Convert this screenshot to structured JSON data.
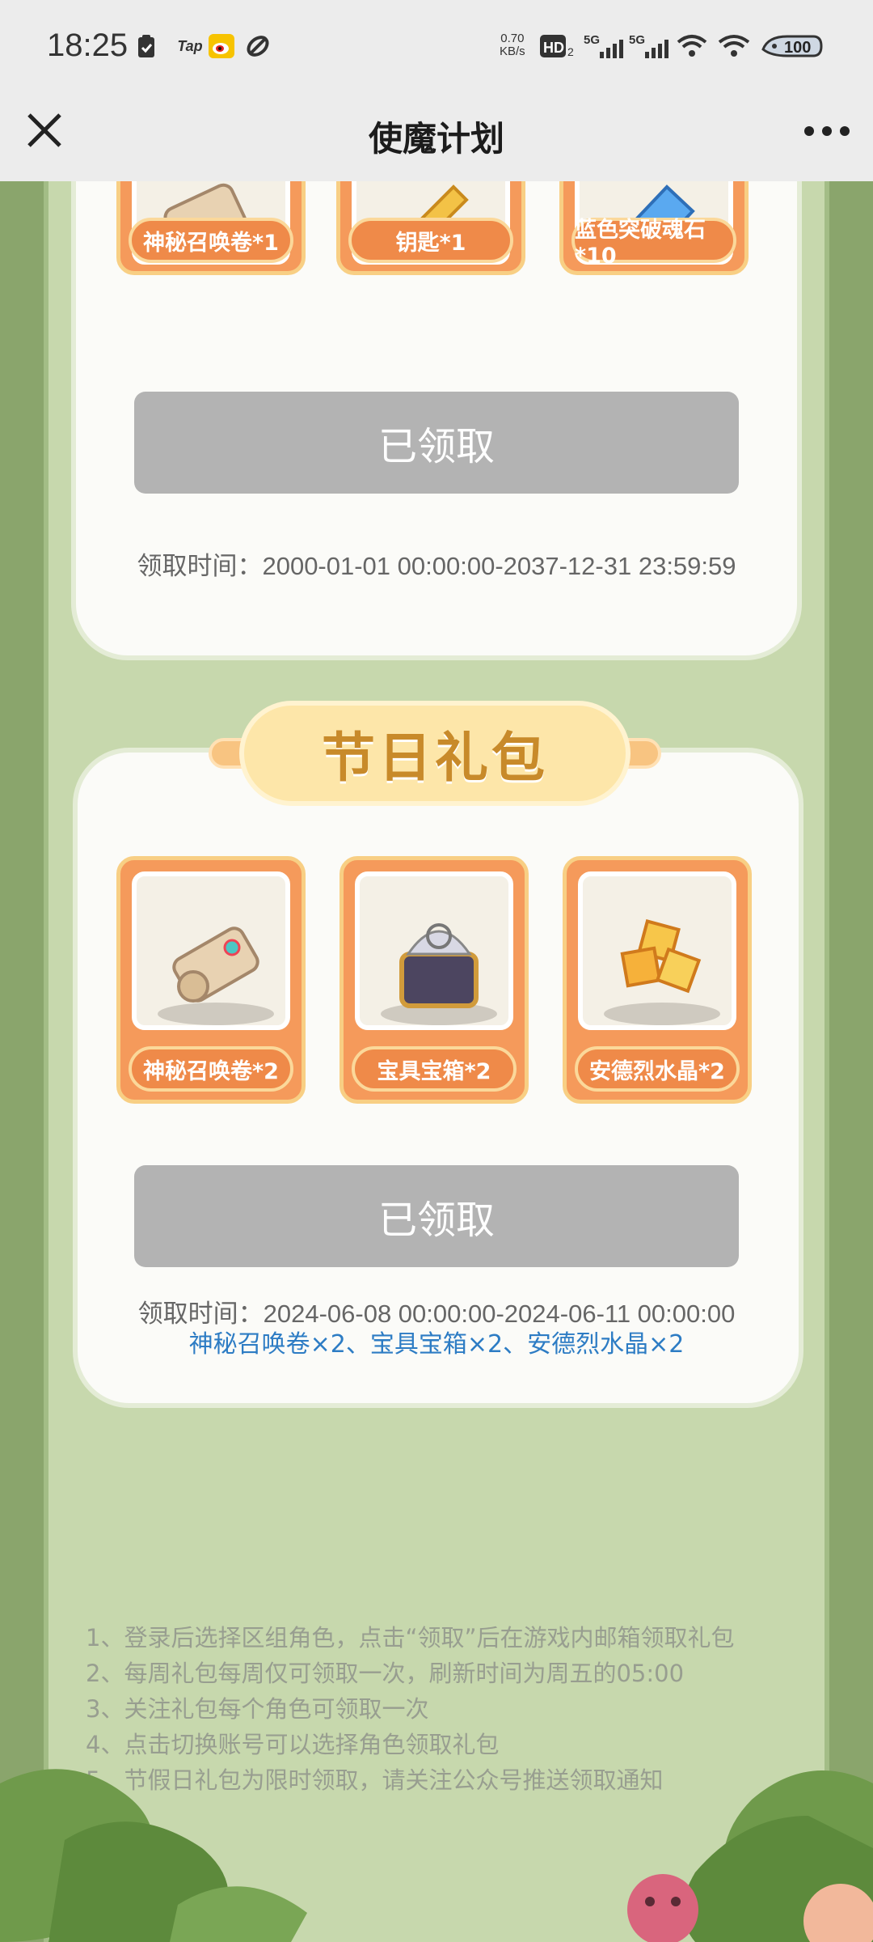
{
  "status_bar": {
    "time": "18:25",
    "tap_label": "Tap",
    "speed_value": "0.70",
    "speed_unit": "KB/s",
    "network1": "5G",
    "network2": "5G",
    "battery": "100"
  },
  "header": {
    "title": "使魔计划"
  },
  "weekly_gift": {
    "items": [
      {
        "label": "神秘召唤卷*1",
        "icon": "scroll-icon"
      },
      {
        "label": "钥匙*1",
        "icon": "key-icon"
      },
      {
        "label": "蓝色突破魂石*10",
        "icon": "blue-crystal-icon"
      }
    ],
    "button_label": "已领取",
    "time_text": "领取时间：2000-01-01 00:00:00-2037-12-31 23:59:59"
  },
  "holiday_gift": {
    "title": "节日礼包",
    "items": [
      {
        "label": "神秘召唤卷*2",
        "icon": "scroll-icon"
      },
      {
        "label": "宝具宝箱*2",
        "icon": "treasure-chest-icon"
      },
      {
        "label": "安德烈水晶*2",
        "icon": "gold-crystal-icon"
      }
    ],
    "button_label": "已领取",
    "time_text": "领取时间：2024-06-08 00:00:00-2024-06-11 00:00:00",
    "reward_text": "神秘召唤卷×2、宝具宝箱×2、安德烈水晶×2"
  },
  "rules": [
    "1、登录后选择区组角色，点击“领取”后在游戏内邮箱领取礼包",
    "2、每周礼包每周仅可领取一次，刷新时间为周五的05:00",
    "3、关注礼包每个角色可领取一次",
    "4、点击切换账号可以选择角色领取礼包",
    "5、节假日礼包为限时领取，请关注公众号推送领取通知"
  ],
  "colors": {
    "background_green": "#8aa56c",
    "panel_green": "#c7d8ad",
    "item_orange": "#f59a5b",
    "button_gray": "#b3b3b3",
    "link_blue": "#2d7cc4"
  }
}
